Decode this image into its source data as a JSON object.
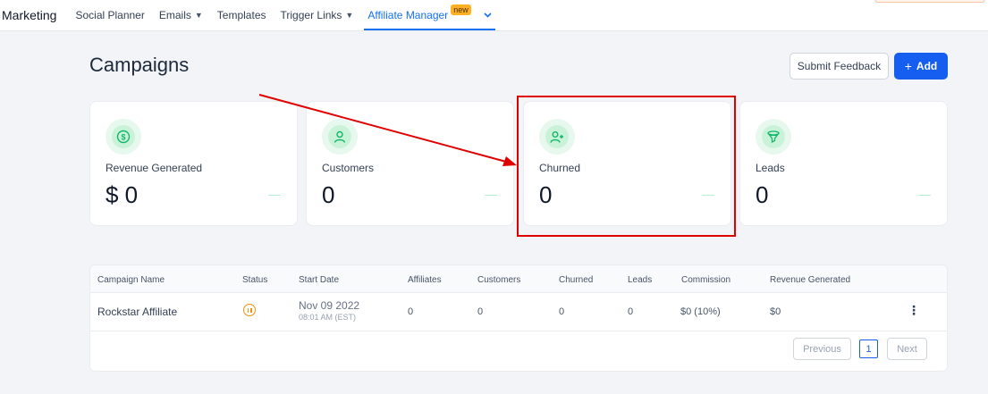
{
  "nav": {
    "brand": "Marketing",
    "items": [
      {
        "label": "Social Planner"
      },
      {
        "label": "Emails",
        "chevron": "chevron-down-icon"
      },
      {
        "label": "Templates"
      },
      {
        "label": "Trigger Links",
        "chevron": "chevron-down-icon"
      },
      {
        "label": "Affiliate Manager",
        "badge": "new",
        "active": true
      }
    ]
  },
  "header": {
    "title": "Campaigns",
    "feedback_label": "Submit Feedback",
    "add_icon": "+",
    "add_label": "Add"
  },
  "stats": [
    {
      "label": "Revenue Generated",
      "value": "$ 0",
      "icon": "dollar-icon"
    },
    {
      "label": "Customers",
      "value": "0",
      "icon": "user-icon"
    },
    {
      "label": "Churned",
      "value": "0",
      "icon": "user-plus-icon"
    },
    {
      "label": "Leads",
      "value": "0",
      "icon": "funnel-icon"
    }
  ],
  "colors": {
    "accent": "#155eef",
    "annotation": "#e00000",
    "status_paused": "#f79009",
    "stat_icon_bg": "#e7f8ee"
  },
  "table": {
    "columns": [
      "Campaign Name",
      "Status",
      "Start Date",
      "Affiliates",
      "Customers",
      "Churned",
      "Leads",
      "Commission",
      "Revenue Generated"
    ],
    "rows": [
      {
        "name": "Rockstar Affiliate",
        "status_icon": "pause-icon",
        "start_date": "Nov 09 2022",
        "start_time": "08:01 AM (EST)",
        "affiliates": "0",
        "customers": "0",
        "churned": "0",
        "leads": "0",
        "commission": "$0 (10%)",
        "revenue": "$0",
        "menu_icon": "more-vertical-icon"
      }
    ],
    "pagination": {
      "previous": "Previous",
      "page": "1",
      "next": "Next"
    }
  }
}
